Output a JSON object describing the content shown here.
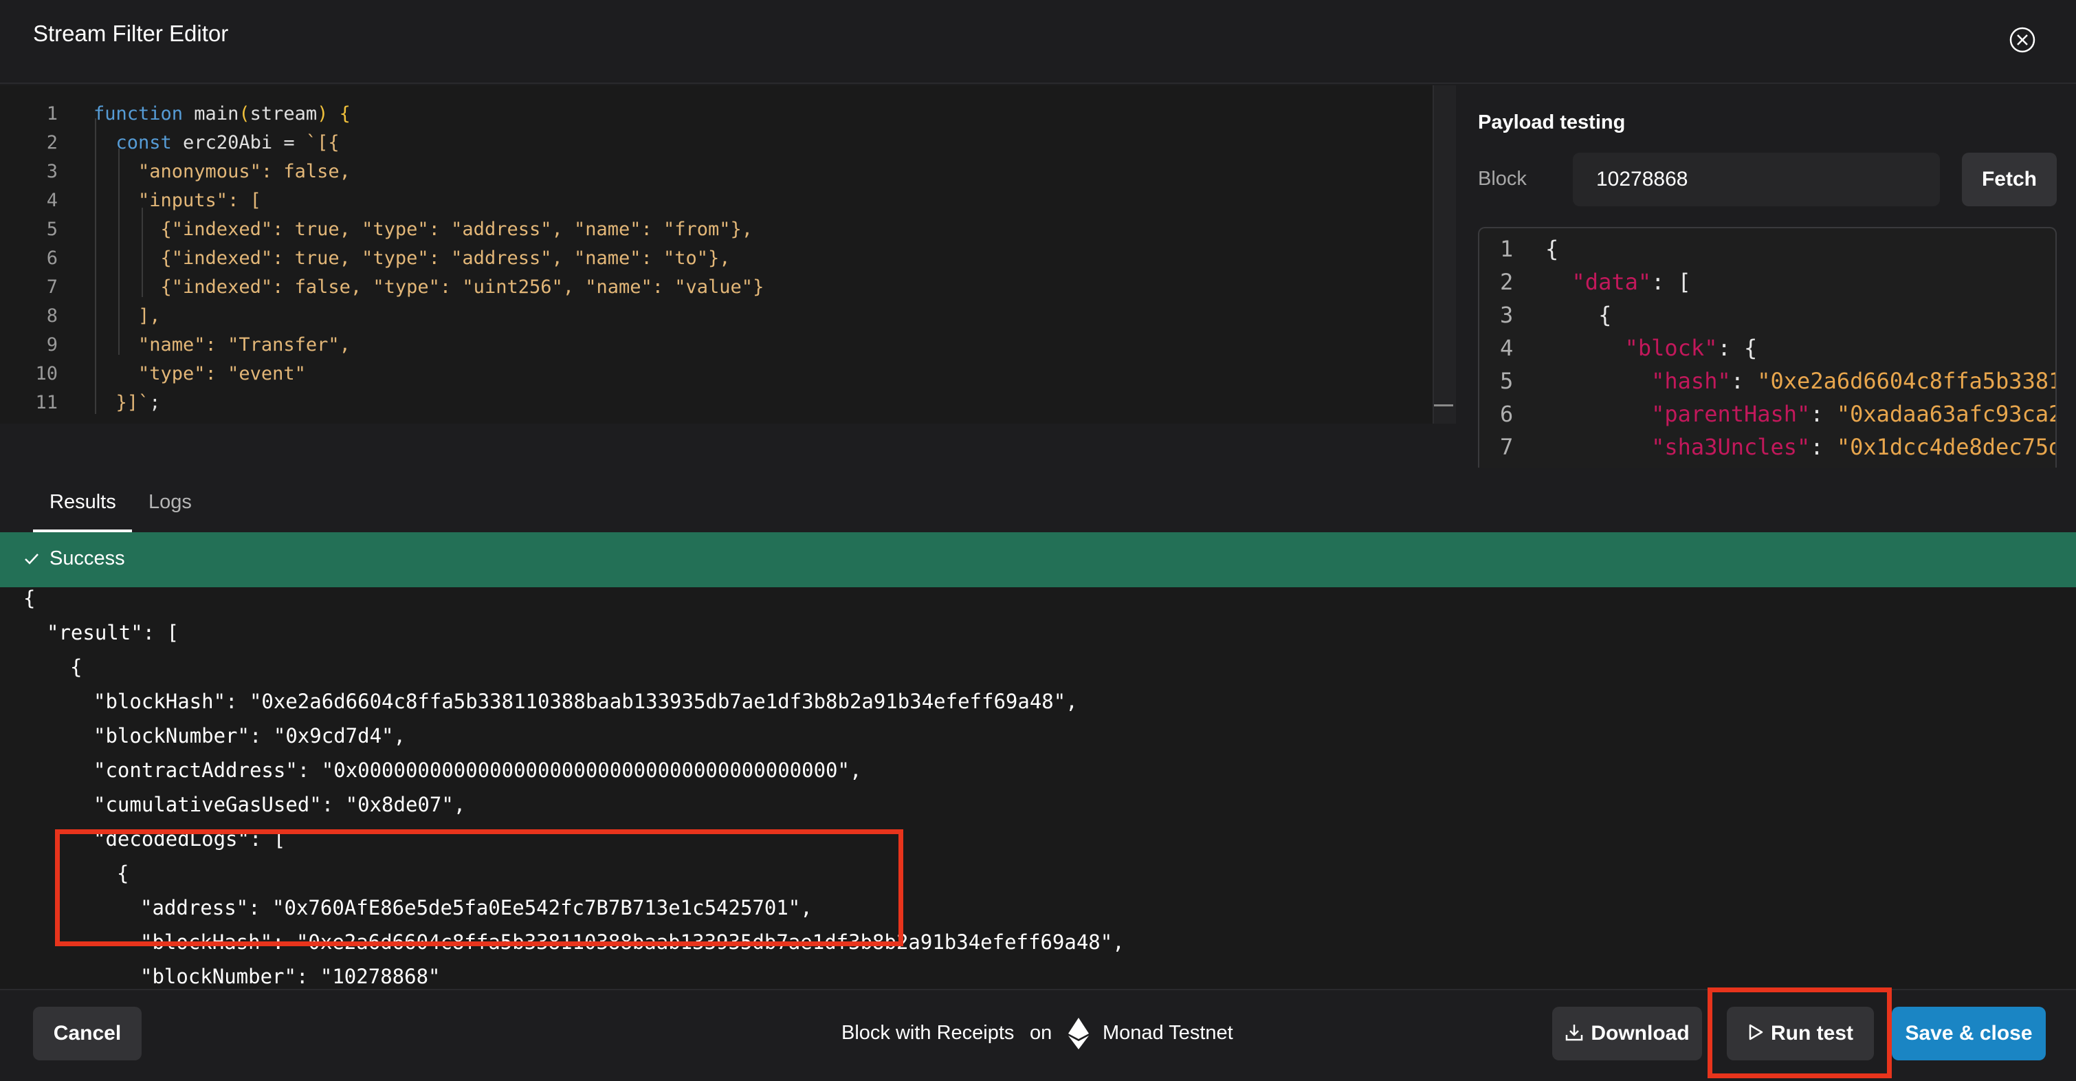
{
  "window": {
    "title": "Stream Filter Editor",
    "close_icon": "close-circle-icon"
  },
  "editor": {
    "lines": [
      {
        "n": "1",
        "tokens": [
          {
            "t": "function",
            "c": "k"
          },
          {
            "t": " main",
            "c": "w"
          },
          {
            "t": "(",
            "c": "p"
          },
          {
            "t": "stream",
            "c": "w"
          },
          {
            "t": ")",
            "c": "p"
          },
          {
            "t": " {",
            "c": "p"
          }
        ]
      },
      {
        "n": "2",
        "tokens": [
          {
            "t": "  const",
            "c": "k"
          },
          {
            "t": " erc20Abi = ",
            "c": "w"
          },
          {
            "t": "`[{",
            "c": "s"
          }
        ]
      },
      {
        "n": "3",
        "tokens": [
          {
            "t": "    \"anonymous\": false,",
            "c": "s"
          }
        ]
      },
      {
        "n": "4",
        "tokens": [
          {
            "t": "    \"inputs\": [",
            "c": "s"
          }
        ]
      },
      {
        "n": "5",
        "tokens": [
          {
            "t": "      {\"indexed\": true, \"type\": \"address\", \"name\": \"from\"},",
            "c": "s"
          }
        ]
      },
      {
        "n": "6",
        "tokens": [
          {
            "t": "      {\"indexed\": true, \"type\": \"address\", \"name\": \"to\"},",
            "c": "s"
          }
        ]
      },
      {
        "n": "7",
        "tokens": [
          {
            "t": "      {\"indexed\": false, \"type\": \"uint256\", \"name\": \"value\"}",
            "c": "s"
          }
        ]
      },
      {
        "n": "8",
        "tokens": [
          {
            "t": "    ],",
            "c": "s"
          }
        ]
      },
      {
        "n": "9",
        "tokens": [
          {
            "t": "    \"name\": \"Transfer\",",
            "c": "s"
          }
        ]
      },
      {
        "n": "10",
        "tokens": [
          {
            "t": "    \"type\": \"event\"",
            "c": "s"
          }
        ]
      },
      {
        "n": "11",
        "tokens": [
          {
            "t": "  }]`",
            "c": "s"
          },
          {
            "t": ";",
            "c": "w"
          }
        ]
      }
    ]
  },
  "payload": {
    "title": "Payload testing",
    "block_label": "Block",
    "block_value": "10278868",
    "fetch_label": "Fetch",
    "json_lines": [
      {
        "n": "1",
        "tokens": [
          {
            "t": "{",
            "c": ""
          }
        ]
      },
      {
        "n": "2",
        "tokens": [
          {
            "t": "  ",
            "c": ""
          },
          {
            "t": "\"data\"",
            "c": "key"
          },
          {
            "t": ": [",
            "c": ""
          }
        ]
      },
      {
        "n": "3",
        "tokens": [
          {
            "t": "    {",
            "c": ""
          }
        ]
      },
      {
        "n": "4",
        "tokens": [
          {
            "t": "      ",
            "c": ""
          },
          {
            "t": "\"block\"",
            "c": "key"
          },
          {
            "t": ": {",
            "c": ""
          }
        ]
      },
      {
        "n": "5",
        "tokens": [
          {
            "t": "        ",
            "c": ""
          },
          {
            "t": "\"hash\"",
            "c": "key"
          },
          {
            "t": ": ",
            "c": ""
          },
          {
            "t": "\"0xe2a6d6604c8ffa5b3381",
            "c": "str"
          }
        ]
      },
      {
        "n": "6",
        "tokens": [
          {
            "t": "        ",
            "c": ""
          },
          {
            "t": "\"parentHash\"",
            "c": "key"
          },
          {
            "t": ": ",
            "c": ""
          },
          {
            "t": "\"0xadaa63afc93ca2",
            "c": "str"
          }
        ]
      },
      {
        "n": "7",
        "tokens": [
          {
            "t": "        ",
            "c": ""
          },
          {
            "t": "\"sha3Uncles\"",
            "c": "key"
          },
          {
            "t": ": ",
            "c": ""
          },
          {
            "t": "\"0x1dcc4de8dec75d",
            "c": "str"
          }
        ]
      }
    ]
  },
  "tabs": {
    "results": "Results",
    "logs": "Logs"
  },
  "status": {
    "text": "Success",
    "icon": "check-icon"
  },
  "results": {
    "lines": [
      {
        "indent": 0,
        "text": "{"
      },
      {
        "indent": 1,
        "text": "\"result\": ["
      },
      {
        "indent": 2,
        "text": "{"
      },
      {
        "indent": 3,
        "text": "\"blockHash\": \"0xe2a6d6604c8ffa5b338110388baab133935db7ae1df3b8b2a91b34efeff69a48\","
      },
      {
        "indent": 3,
        "text": "\"blockNumber\": \"0x9cd7d4\","
      },
      {
        "indent": 3,
        "text": "\"contractAddress\": \"0x0000000000000000000000000000000000000000\","
      },
      {
        "indent": 3,
        "text": "\"cumulativeGasUsed\": \"0x8de07\","
      },
      {
        "indent": 3,
        "text": "\"decodedLogs\": ["
      },
      {
        "indent": 4,
        "text": "{"
      },
      {
        "indent": 5,
        "text": "\"address\": \"0x760AfE86e5de5fa0Ee542fc7B7B713e1c5425701\","
      },
      {
        "indent": 5,
        "text": "\"blockHash\": \"0xe2a6d6604c8ffa5b338110388baab133935db7ae1df3b8b2a91b34efeff69a48\","
      },
      {
        "indent": 5,
        "text": "\"blockNumber\": \"10278868\""
      }
    ]
  },
  "footer": {
    "cancel_label": "Cancel",
    "dataset_label": "Block with Receipts",
    "on_label": "on",
    "network_label": "Monad Testnet",
    "network_icon": "ethereum-icon",
    "download_label": "Download",
    "download_icon": "download-icon",
    "run_label": "Run test",
    "run_icon": "play-icon",
    "save_label": "Save & close"
  },
  "colors": {
    "background": "#1d1d1f",
    "success": "#237056",
    "primary": "#1a85c4",
    "annotation": "#e8341c",
    "keyword": "#569cd6",
    "string": "#e3b778",
    "json_key": "#c2185b"
  }
}
